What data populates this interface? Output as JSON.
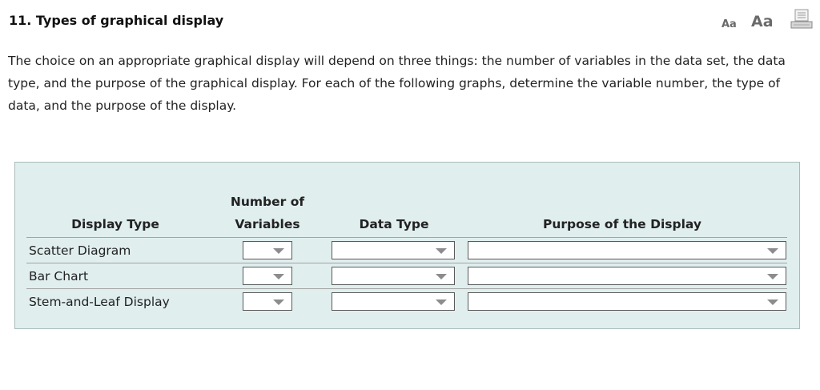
{
  "header": {
    "title": "11. Types of graphical display",
    "font_small_label": "Aa",
    "font_large_label": "Aa",
    "print_icon": "printer-icon"
  },
  "intro": {
    "text": "The choice on an appropriate graphical display will depend on three things: the number of variables in the data set, the data type, and the purpose of the graphical display. For each of the following graphs, determine the variable number, the type of data, and the purpose of the display."
  },
  "table": {
    "columns": {
      "display_type": "Display Type",
      "number_of_variables": "Number of Variables",
      "data_type": "Data Type",
      "purpose": "Purpose of the Display"
    },
    "rows": [
      {
        "label": "Scatter Diagram",
        "number_value": "",
        "data_type_value": "",
        "purpose_value": ""
      },
      {
        "label": "Bar Chart",
        "number_value": "",
        "data_type_value": "",
        "purpose_value": ""
      },
      {
        "label": "Stem-and-Leaf Display",
        "number_value": "",
        "data_type_value": "",
        "purpose_value": ""
      }
    ]
  },
  "colors": {
    "panel_background": "#e0eeee",
    "panel_border": "#a9bcbc",
    "row_divider": "#a3a3a3",
    "dropdown_arrow": "#8c8c8c",
    "text": "#222222"
  }
}
